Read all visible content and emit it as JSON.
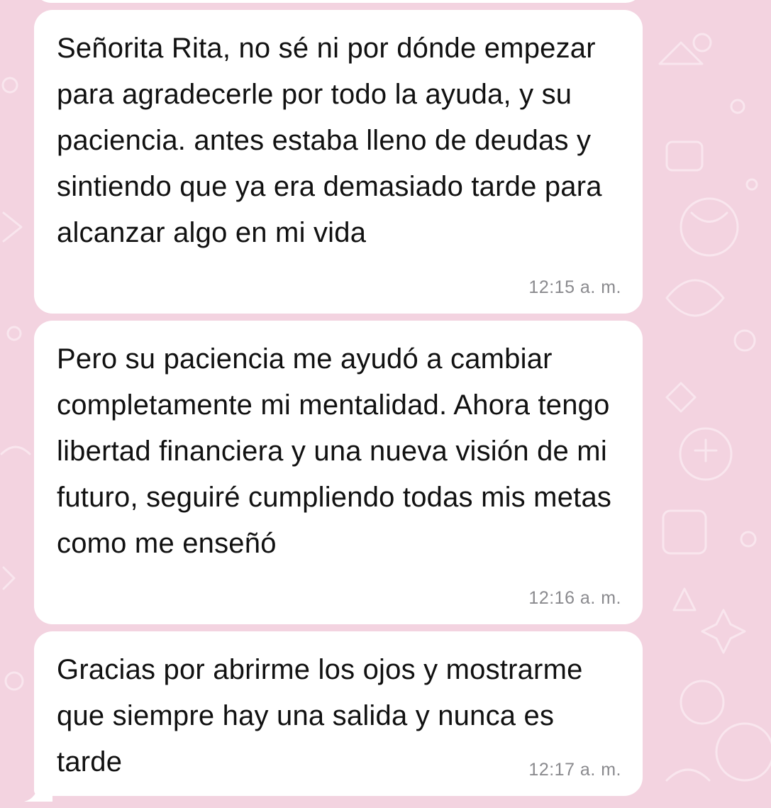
{
  "chat": {
    "messages": [
      {
        "text": "Señorita Rita, no sé ni por dónde empezar para agradecerle por todo la ayuda, y su paciencia. antes estaba lleno de deudas y sintiendo que ya era demasiado tarde para alcanzar algo en mi vida",
        "time": "12:15 a. m."
      },
      {
        "text": "Pero su paciencia me ayudó a cambiar completamente mi mentalidad. Ahora tengo libertad financiera y una nueva visión de mi futuro, seguiré cumpliendo todas mis metas como me enseñó",
        "time": "12:16 a. m."
      },
      {
        "text": "Gracias por abrirme los ojos y mostrarme que siempre hay una salida y nunca es tarde",
        "time": "12:17 a. m."
      }
    ]
  },
  "colors": {
    "wallpaper": "#f3d3e0",
    "wallpaper_doodle": "#f8e3ec",
    "bubble": "#ffffff",
    "text": "#111111",
    "time": "#8a8a8e"
  }
}
